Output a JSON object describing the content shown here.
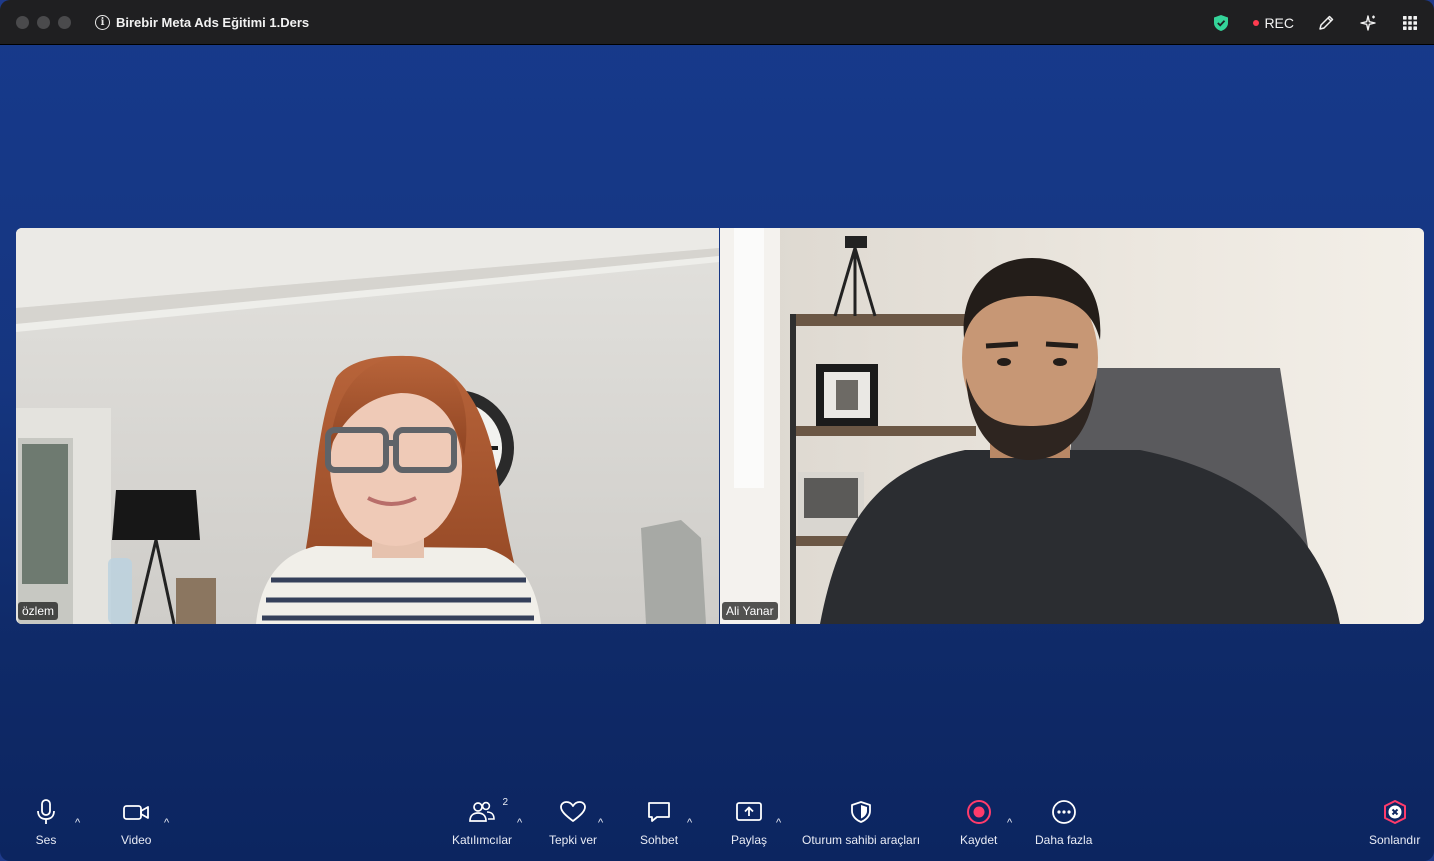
{
  "window": {
    "title": "Birebir Meta Ads Eğitimi 1.Ders",
    "rec_label": "REC"
  },
  "participants": [
    {
      "name": "özlem"
    },
    {
      "name": "Ali Yanar"
    }
  ],
  "toolbar": {
    "audio_label": "Ses",
    "video_label": "Video",
    "participants_label": "Katılımcılar",
    "participants_count": "2",
    "reactions_label": "Tepki ver",
    "chat_label": "Sohbet",
    "share_label": "Paylaş",
    "host_tools_label": "Oturum sahibi araçları",
    "record_label": "Kaydet",
    "more_label": "Daha fazla",
    "end_label": "Sonlandır"
  },
  "icons": {
    "security": "shield-icon",
    "annotate": "pen-icon",
    "ai": "sparkle-icon",
    "apps": "grid-icon"
  },
  "colors": {
    "rec": "#ff3b4f",
    "shield": "#34d399",
    "end": "#ff3b6b"
  }
}
